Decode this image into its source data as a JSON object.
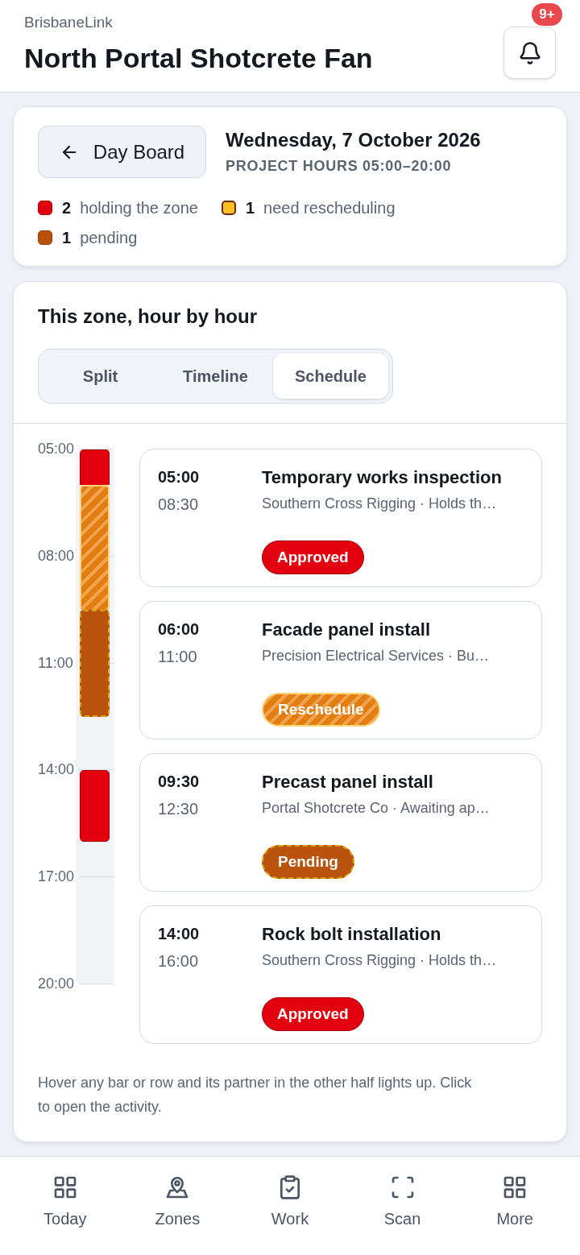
{
  "header": {
    "app_name": "BrisbaneLink",
    "title": "North Portal Shotcrete Fan",
    "notification_badge": "9+"
  },
  "day_card": {
    "back_button": {
      "label": "Day Board"
    },
    "date": "Wednesday, 7 October 2026",
    "hours": "PROJECT HOURS 05:00–20:00",
    "legend": [
      {
        "kind": "approved",
        "count": "2",
        "label": "holding the zone"
      },
      {
        "kind": "reschedule",
        "count": "1",
        "label": "need rescheduling"
      },
      {
        "kind": "pending",
        "count": "1",
        "label": "pending"
      }
    ]
  },
  "schedule_panel": {
    "title": "This zone, hour by hour",
    "view_tabs": [
      {
        "label": "Split",
        "selected": false
      },
      {
        "label": "Timeline",
        "selected": false
      },
      {
        "label": "Schedule",
        "selected": true
      }
    ],
    "axis_ticks": [
      "05:00",
      "08:00",
      "11:00",
      "14:00",
      "17:00",
      "20:00"
    ],
    "activities": [
      {
        "start": "05:00",
        "end": "08:30",
        "title": "Temporary works inspection",
        "detail": "Southern Cross Rigging · Holds th…",
        "status": {
          "label": "Approved",
          "kind": "approved"
        }
      },
      {
        "start": "06:00",
        "end": "11:00",
        "title": "Facade panel install",
        "detail": "Precision Electrical Services · Bu…",
        "status": {
          "label": "Reschedule",
          "kind": "reschedule"
        }
      },
      {
        "start": "09:30",
        "end": "12:30",
        "title": "Precast panel install",
        "detail": "Portal Shotcrete Co · Awaiting ap…",
        "status": {
          "label": "Pending",
          "kind": "pending"
        }
      },
      {
        "start": "14:00",
        "end": "16:00",
        "title": "Rock bolt installation",
        "detail": "Southern Cross Rigging · Holds th…",
        "status": {
          "label": "Approved",
          "kind": "approved"
        }
      }
    ],
    "hint": "Hover any bar or row and its partner in the other half lights up. Click to open the activity."
  },
  "bottom_nav": [
    {
      "label": "Today"
    },
    {
      "label": "Zones"
    },
    {
      "label": "Work"
    },
    {
      "label": "Scan"
    },
    {
      "label": "More"
    }
  ]
}
